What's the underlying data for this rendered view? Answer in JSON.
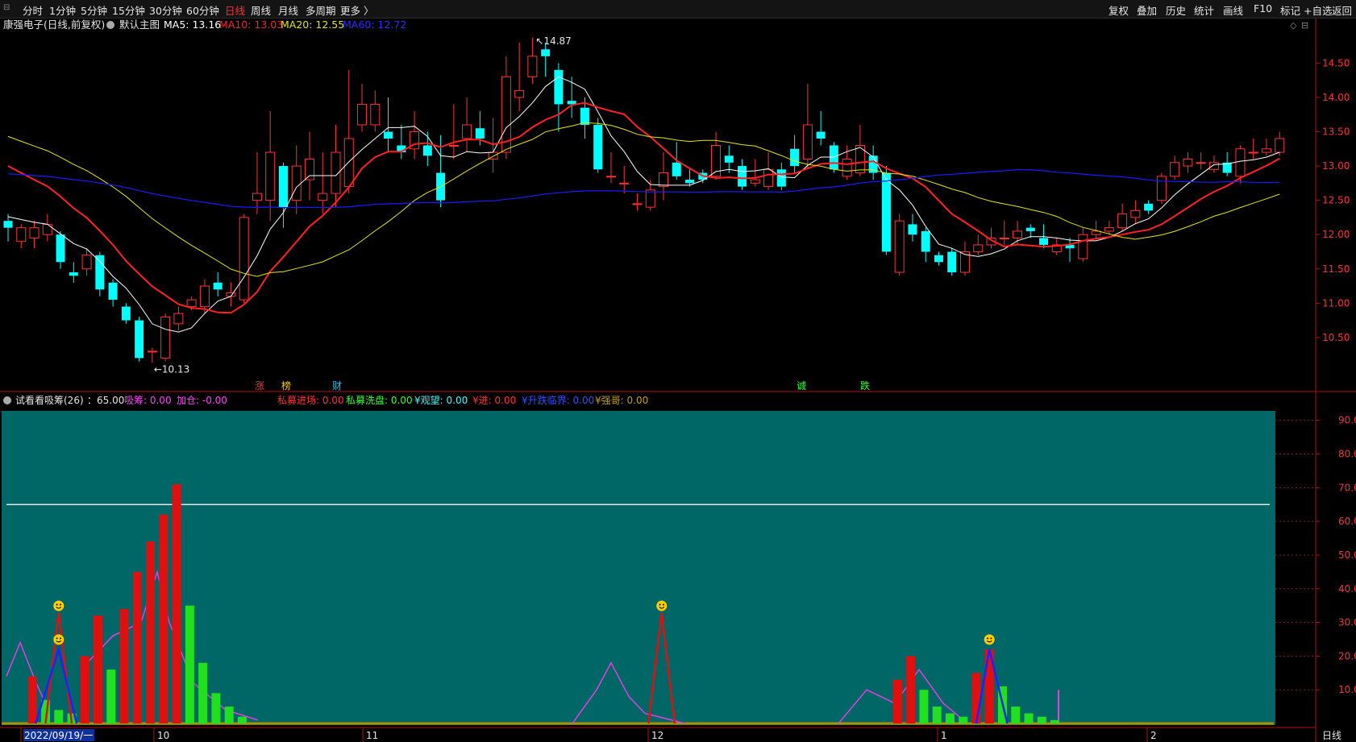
{
  "toolbar": {
    "periods": [
      "分时",
      "1分钟",
      "5分钟",
      "15分钟",
      "30分钟",
      "60分钟",
      "日线",
      "周线",
      "月线",
      "多周期",
      "更多 〉"
    ],
    "active_period": "日线",
    "right_items": [
      "复权",
      "叠加",
      "历史",
      "统计",
      "画线",
      "F10",
      "标记",
      "+自选",
      "返回"
    ]
  },
  "main_legend": {
    "stock": "康强电子(日线,前复权)",
    "template": "默认主图",
    "ma5": "MA5: 13.16",
    "ma10": "MA10: 13.03",
    "ma20": "MA20: 12.55",
    "ma60": "MA60: 12.72"
  },
  "sub_legend": {
    "name": "试看看吸筹(26)",
    "v1": "：65.00",
    "xichou": "吸筹: 0.00",
    "jiacang": "加仓: -0.00",
    "simu_jinchang": "私募进场: 0.00",
    "simu_xipan": "私募洗盘: 0.00",
    "guanwang": "¥观望: 0.00",
    "jin": "¥进: 0.00",
    "shengfu": "¥升跌临界: 0.00",
    "qiangge": "¥强哥: 0.00"
  },
  "colors": {
    "up": "#ff3232",
    "down": "#00ffff",
    "ma5": "#ffffff",
    "ma10": "#ff2020",
    "ma20": "#e6e600",
    "ma60": "#1a1aff",
    "sub_bg": "#006666",
    "axis": "#b01010"
  },
  "chart_data": [
    {
      "type": "candlestick",
      "y_ticks": [
        "14.50",
        "14.00",
        "13.50",
        "13.00",
        "12.50",
        "12.00",
        "11.50",
        "11.00",
        "10.50"
      ],
      "ylim": [
        9.9,
        14.95
      ],
      "annotations": {
        "high": "14.87",
        "low": "10.13"
      },
      "markers": [
        "涨",
        "榜",
        "财",
        "诚",
        "跌"
      ],
      "candles": [
        [
          12.2,
          12.1,
          12.3,
          11.9
        ],
        [
          11.9,
          12.1,
          12.15,
          11.8
        ],
        [
          11.95,
          12.1,
          12.2,
          11.8
        ],
        [
          12.0,
          12.15,
          12.3,
          11.9
        ],
        [
          12.0,
          11.6,
          12.05,
          11.5
        ],
        [
          11.45,
          11.4,
          11.6,
          11.3
        ],
        [
          11.5,
          11.7,
          11.8,
          11.4
        ],
        [
          11.7,
          11.2,
          11.75,
          11.1
        ],
        [
          11.3,
          11.05,
          11.35,
          10.95
        ],
        [
          10.95,
          10.75,
          11.0,
          10.7
        ],
        [
          10.75,
          10.2,
          10.8,
          10.15
        ],
        [
          10.3,
          10.3,
          10.35,
          10.13
        ],
        [
          10.2,
          10.8,
          10.85,
          10.15
        ],
        [
          10.7,
          10.85,
          10.95,
          10.6
        ],
        [
          10.95,
          11.05,
          11.1,
          10.9
        ],
        [
          10.95,
          11.25,
          11.35,
          10.85
        ],
        [
          11.3,
          11.2,
          11.45,
          11.1
        ],
        [
          11.1,
          11.15,
          11.3,
          10.95
        ],
        [
          11.05,
          12.25,
          12.3,
          11.0
        ],
        [
          12.5,
          12.6,
          13.2,
          12.3
        ],
        [
          12.5,
          13.2,
          13.8,
          12.2
        ],
        [
          13.0,
          12.4,
          13.05,
          12.1
        ],
        [
          12.5,
          13.0,
          13.3,
          12.3
        ],
        [
          12.8,
          13.1,
          13.5,
          12.5
        ],
        [
          12.5,
          12.6,
          13.2,
          12.3
        ],
        [
          12.6,
          13.2,
          13.6,
          12.4
        ],
        [
          12.7,
          13.4,
          14.4,
          12.6
        ],
        [
          13.6,
          13.9,
          14.2,
          13.5
        ],
        [
          13.6,
          13.9,
          14.1,
          13.5
        ],
        [
          13.5,
          13.4,
          14.0,
          13.2
        ],
        [
          13.3,
          13.2,
          13.6,
          13.1
        ],
        [
          13.25,
          13.5,
          13.8,
          13.1
        ],
        [
          13.3,
          13.15,
          13.5,
          13.0
        ],
        [
          12.9,
          12.5,
          13.45,
          12.4
        ],
        [
          13.3,
          13.3,
          13.9,
          13.1
        ],
        [
          13.4,
          13.6,
          14.0,
          13.2
        ],
        [
          13.55,
          13.4,
          13.8,
          13.3
        ],
        [
          13.1,
          13.2,
          13.7,
          12.9
        ],
        [
          13.2,
          14.3,
          14.6,
          13.1
        ],
        [
          14.0,
          14.1,
          14.8,
          13.8
        ],
        [
          14.3,
          14.6,
          14.87,
          14.2
        ],
        [
          14.7,
          14.6,
          14.8,
          14.3
        ],
        [
          14.4,
          13.9,
          14.5,
          13.5
        ],
        [
          13.95,
          13.9,
          14.3,
          13.7
        ],
        [
          13.85,
          13.6,
          14.0,
          13.4
        ],
        [
          13.6,
          12.95,
          13.7,
          12.9
        ],
        [
          12.85,
          12.85,
          13.2,
          12.75
        ],
        [
          12.75,
          12.75,
          13.0,
          12.6
        ],
        [
          12.45,
          12.45,
          12.6,
          12.35
        ],
        [
          12.4,
          12.65,
          12.8,
          12.35
        ],
        [
          12.7,
          12.9,
          13.2,
          12.5
        ],
        [
          13.05,
          12.85,
          13.35,
          12.8
        ],
        [
          12.8,
          12.75,
          12.95,
          12.7
        ],
        [
          12.9,
          12.8,
          12.95,
          12.75
        ],
        [
          12.85,
          13.3,
          13.5,
          12.8
        ],
        [
          13.15,
          13.05,
          13.3,
          12.9
        ],
        [
          13.0,
          12.7,
          13.1,
          12.65
        ],
        [
          12.75,
          12.8,
          13.1,
          12.7
        ],
        [
          12.7,
          12.95,
          13.2,
          12.65
        ],
        [
          12.95,
          12.7,
          13.05,
          12.65
        ],
        [
          13.25,
          13.0,
          13.45,
          12.9
        ],
        [
          13.1,
          13.6,
          14.2,
          12.95
        ],
        [
          13.5,
          13.4,
          13.8,
          13.3
        ],
        [
          13.3,
          12.95,
          13.35,
          12.9
        ],
        [
          12.85,
          13.1,
          13.3,
          12.8
        ],
        [
          12.9,
          13.3,
          13.6,
          12.85
        ],
        [
          13.15,
          12.9,
          13.3,
          12.8
        ],
        [
          12.9,
          11.75,
          13.0,
          11.7
        ],
        [
          11.45,
          12.2,
          12.3,
          11.4
        ],
        [
          12.15,
          12.0,
          12.3,
          11.9
        ],
        [
          12.05,
          11.75,
          12.1,
          11.6
        ],
        [
          11.7,
          11.6,
          11.75,
          11.55
        ],
        [
          11.75,
          11.45,
          11.8,
          11.4
        ],
        [
          11.45,
          11.75,
          11.9,
          11.4
        ],
        [
          11.75,
          11.85,
          12.0,
          11.7
        ],
        [
          11.85,
          11.95,
          12.1,
          11.8
        ],
        [
          11.95,
          11.95,
          12.2,
          11.85
        ],
        [
          11.95,
          12.05,
          12.2,
          11.85
        ],
        [
          12.1,
          12.05,
          12.15,
          11.95
        ],
        [
          11.95,
          11.85,
          12.15,
          11.8
        ],
        [
          11.75,
          11.85,
          11.95,
          11.7
        ],
        [
          11.85,
          11.8,
          11.95,
          11.6
        ],
        [
          11.65,
          12.0,
          12.1,
          11.6
        ],
        [
          12.0,
          12.05,
          12.2,
          11.95
        ],
        [
          12.05,
          12.1,
          12.2,
          12.0
        ],
        [
          12.1,
          12.3,
          12.45,
          12.05
        ],
        [
          12.25,
          12.35,
          12.5,
          12.15
        ],
        [
          12.45,
          12.35,
          12.5,
          12.3
        ],
        [
          12.5,
          12.85,
          12.9,
          12.45
        ],
        [
          12.85,
          13.05,
          13.15,
          12.8
        ],
        [
          13.0,
          13.1,
          13.2,
          12.9
        ],
        [
          13.05,
          13.05,
          13.2,
          12.95
        ],
        [
          12.95,
          13.05,
          13.15,
          12.9
        ],
        [
          13.05,
          12.9,
          13.2,
          12.85
        ],
        [
          12.85,
          13.25,
          13.3,
          12.75
        ],
        [
          13.2,
          13.2,
          13.4,
          13.1
        ],
        [
          13.2,
          13.25,
          13.4,
          13.15
        ],
        [
          13.2,
          13.4,
          13.5,
          13.15
        ]
      ]
    },
    {
      "type": "bar",
      "y_ticks": [
        "90.00",
        "80.00",
        "70.00",
        "60.00",
        "50.00",
        "40.00",
        "30.00",
        "20.00",
        "10.00"
      ],
      "ylim": [
        0,
        94
      ],
      "hline": 65,
      "x_labels": [
        "2022/09/19/一",
        "10",
        "11",
        "12",
        "1",
        "2"
      ],
      "red_bars": [
        [
          1,
          14
        ],
        [
          5,
          20
        ],
        [
          6,
          32
        ],
        [
          8,
          34
        ],
        [
          9,
          45
        ],
        [
          10,
          54
        ],
        [
          11,
          62
        ],
        [
          12,
          71
        ],
        [
          67,
          13
        ],
        [
          68,
          20
        ],
        [
          73,
          15
        ],
        [
          74,
          22
        ]
      ],
      "green_bars": [
        [
          2,
          7
        ],
        [
          3,
          4
        ],
        [
          4,
          3
        ],
        [
          7,
          16
        ],
        [
          13,
          35
        ],
        [
          14,
          18
        ],
        [
          15,
          9
        ],
        [
          16,
          5
        ],
        [
          17,
          2
        ],
        [
          69,
          10
        ],
        [
          70,
          5
        ],
        [
          71,
          3
        ],
        [
          72,
          2
        ],
        [
          75,
          11
        ],
        [
          76,
          5
        ],
        [
          77,
          3
        ],
        [
          78,
          2
        ],
        [
          79,
          1
        ]
      ],
      "smiles": [
        [
          3,
          33
        ],
        [
          3,
          23
        ],
        [
          49,
          33
        ],
        [
          74,
          23
        ]
      ]
    }
  ]
}
